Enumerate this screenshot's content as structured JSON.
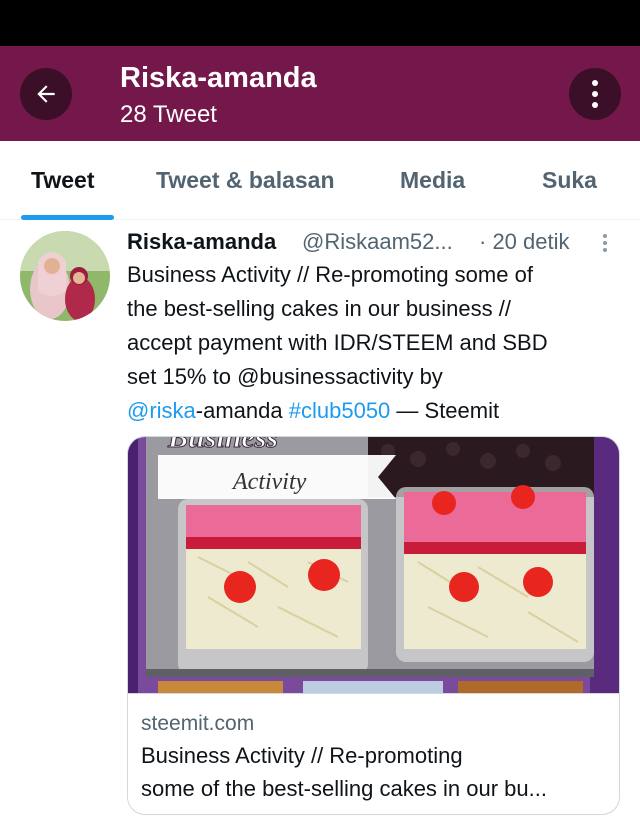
{
  "header": {
    "title": "Riska-amanda",
    "subtitle": "28 Tweet",
    "background_color": "#74184c",
    "back_icon": "arrow-left-icon",
    "more_icon": "more-vertical-icon"
  },
  "tabs": [
    {
      "label": "Tweet",
      "active": true
    },
    {
      "label": "Tweet & balasan",
      "active": false
    },
    {
      "label": "Media",
      "active": false
    },
    {
      "label": "Suka",
      "active": false
    }
  ],
  "tweet": {
    "author_name": "Riska-amanda",
    "handle": "@Riskaam52...",
    "time": "· 20 detik",
    "body_lines": [
      "Business Activity // Re-promoting some of",
      "the best-selling cakes in our business //",
      "accept payment with IDR/STEEM and SBD",
      "set 15% to @businessactivity by"
    ],
    "mention": "@riska",
    "mention_rest": "-amanda ",
    "hashtag": "#club5050",
    "tail": " — Steemit",
    "card": {
      "image_title_partial": "Business",
      "image_subtitle": "Activity",
      "domain": "steemit.com",
      "title_line1": "Business Activity // Re-promoting",
      "title_line2": "some of the best-selling cakes in our bu..."
    }
  },
  "colors": {
    "accent": "#1d9bf0",
    "text": "#0f1419",
    "muted": "#536471"
  }
}
